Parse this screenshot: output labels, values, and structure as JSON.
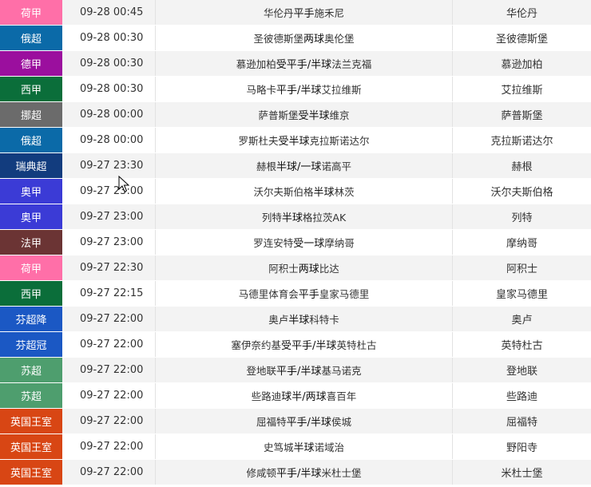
{
  "rows": [
    {
      "league": "荷甲",
      "color": "#ff6fa8",
      "time": "09-28 00:45",
      "home": "华伦丹",
      "handicap": "平手",
      "away": "施禾尼",
      "pick": "华伦丹"
    },
    {
      "league": "俄超",
      "color": "#0b6aa8",
      "time": "09-28 00:30",
      "home": "圣彼德斯堡",
      "handicap": "两球",
      "away": "奥伦堡",
      "pick": "圣彼德斯堡"
    },
    {
      "league": "德甲",
      "color": "#9b0f9e",
      "time": "09-28 00:30",
      "home": "慕逊加柏",
      "handicap": "受平手/半球",
      "away": "法兰克福",
      "pick": "慕逊加柏"
    },
    {
      "league": "西甲",
      "color": "#0b6e3a",
      "time": "09-28 00:30",
      "home": "马略卡",
      "handicap": "平手/半球",
      "away": "艾拉维斯",
      "pick": "艾拉维斯"
    },
    {
      "league": "挪超",
      "color": "#6b6b6b",
      "time": "09-28 00:00",
      "home": "萨普斯堡",
      "handicap": "受半球",
      "away": "维京",
      "pick": "萨普斯堡"
    },
    {
      "league": "俄超",
      "color": "#0b6aa8",
      "time": "09-28 00:00",
      "home": "罗斯杜夫",
      "handicap": "受半球",
      "away": "克拉斯诺达尔",
      "pick": "克拉斯诺达尔"
    },
    {
      "league": "瑞典超",
      "color": "#123c7e",
      "time": "09-27 23:30",
      "home": "赫根",
      "handicap": "半球/一球",
      "away": "诺高平",
      "pick": "赫根"
    },
    {
      "league": "奥甲",
      "color": "#3b3bd6",
      "time": "09-27 23:00",
      "home": "沃尔夫斯伯格",
      "handicap": "半球",
      "away": "林茨",
      "pick": "沃尔夫斯伯格"
    },
    {
      "league": "奥甲",
      "color": "#3b3bd6",
      "time": "09-27 23:00",
      "home": "列特 ",
      "handicap": "半球",
      "away": " 格拉茨AK",
      "pick": "列特"
    },
    {
      "league": "法甲",
      "color": "#6b3434",
      "time": "09-27 23:00",
      "home": "罗连安特",
      "handicap": "受一球",
      "away": "摩纳哥",
      "pick": "摩纳哥"
    },
    {
      "league": "荷甲",
      "color": "#ff6fa8",
      "time": "09-27 22:30",
      "home": "阿积士",
      "handicap": "两球",
      "away": "比达",
      "pick": "阿积士"
    },
    {
      "league": "西甲",
      "color": "#0b6e3a",
      "time": "09-27 22:15",
      "home": "马德里体育会",
      "handicap": "平手",
      "away": "皇家马德里",
      "pick": "皇家马德里"
    },
    {
      "league": "芬超降",
      "color": "#1b58c4",
      "time": "09-27 22:00",
      "home": "奥卢",
      "handicap": "半球",
      "away": "科特卡",
      "pick": "奥卢"
    },
    {
      "league": "芬超冠",
      "color": "#1b58c4",
      "time": "09-27 22:00",
      "home": "塞伊奈约基",
      "handicap": "受平手/半球",
      "away": "英特杜古",
      "pick": "英特杜古"
    },
    {
      "league": "苏超",
      "color": "#4e9e6e",
      "time": "09-27 22:00",
      "home": "登地联",
      "handicap": "平手/半球",
      "away": "基马诺克",
      "pick": "登地联"
    },
    {
      "league": "苏超",
      "color": "#4e9e6e",
      "time": "09-27 22:00",
      "home": "些路迪 ",
      "handicap": "球半/两球",
      "away": " 喜百年",
      "pick": "些路迪"
    },
    {
      "league": "英国王室",
      "color": "#d84614",
      "time": "09-27 22:00",
      "home": "屈福特 ",
      "handicap": "平手/半球",
      "away": " 侯城",
      "pick": "屈福特"
    },
    {
      "league": "英国王室",
      "color": "#d84614",
      "time": "09-27 22:00",
      "home": "史笃城",
      "handicap": "半球",
      "away": "诺域治",
      "pick": "野阳寺"
    },
    {
      "league": "英国王室",
      "color": "#d84614",
      "time": "09-27 22:00",
      "home": "修咸顿",
      "handicap": "平手/半球",
      "away": "米杜士堡",
      "pick": "米杜士堡"
    }
  ]
}
